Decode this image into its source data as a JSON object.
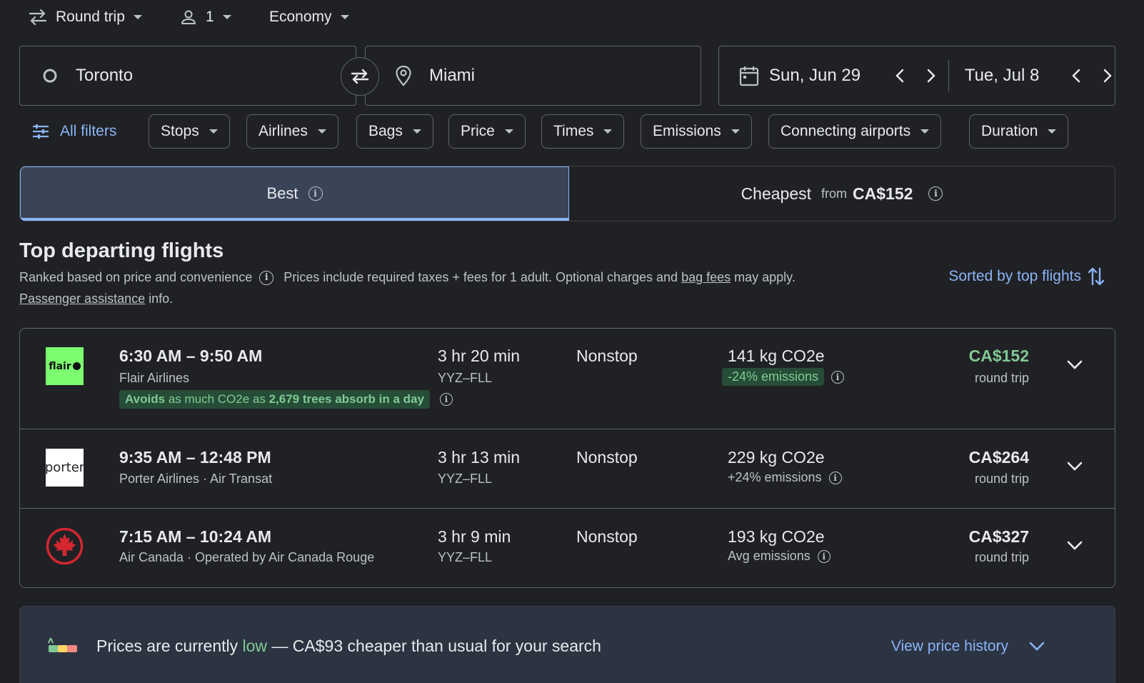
{
  "top_bar": {
    "trip_type": "Round trip",
    "passengers": "1",
    "cabin_class": "Economy"
  },
  "search": {
    "origin": "Toronto",
    "destination": "Miami",
    "depart_date": "Sun, Jun 29",
    "return_date": "Tue, Jul 8"
  },
  "filters": {
    "all_filters": "All filters",
    "chips": [
      "Stops",
      "Airlines",
      "Bags",
      "Price",
      "Times",
      "Emissions",
      "Connecting airports",
      "Duration"
    ]
  },
  "tabs": {
    "best": "Best",
    "cheapest": "Cheapest",
    "cheapest_from": "from",
    "cheapest_price": "CA$152"
  },
  "section": {
    "title": "Top departing flights",
    "ranked": "Ranked based on price and convenience",
    "prices_note_1": "Prices include required taxes + fees for 1 adult. Optional charges and",
    "bag_fees_link": "bag fees",
    "prices_note_2": "may apply.",
    "passenger_link": "Passenger assistance",
    "passenger_suffix": "info.",
    "sorted_by": "Sorted by top flights"
  },
  "flights": [
    {
      "times": "6:30 AM – 9:50 AM",
      "airline": "Flair Airlines",
      "logo_text": "flair",
      "duration": "3 hr 20 min",
      "route": "YYZ–FLL",
      "stops": "Nonstop",
      "co2": "141 kg CO2e",
      "emissions": "-24% emissions",
      "price": "CA$152",
      "price_type": "round trip",
      "avoid_1": "Avoids",
      "avoid_2": "as much CO2e as",
      "avoid_3": "2,679 trees absorb in a day"
    },
    {
      "times": "9:35 AM – 12:48 PM",
      "airline": "Porter Airlines · Air Transat",
      "logo_text": "porter",
      "duration": "3 hr 13 min",
      "route": "YYZ–FLL",
      "stops": "Nonstop",
      "co2": "229 kg CO2e",
      "emissions": "+24% emissions",
      "price": "CA$264",
      "price_type": "round trip"
    },
    {
      "times": "7:15 AM – 10:24 AM",
      "airline": "Air Canada · Operated by Air Canada Rouge",
      "duration": "3 hr 9 min",
      "route": "YYZ–FLL",
      "stops": "Nonstop",
      "co2": "193 kg CO2e",
      "emissions": "Avg emissions",
      "price": "CA$327",
      "price_type": "round trip"
    }
  ],
  "insight": {
    "prefix": "Prices are currently",
    "level": "low",
    "suffix": "— CA$93 cheaper than usual for your search",
    "view_history": "View price history"
  },
  "colors": {
    "background": "#202124",
    "accent_blue": "#8ab4f8",
    "green": "#81c995",
    "flair_green": "#7cfc6f",
    "air_canada_red": "#d22630"
  }
}
